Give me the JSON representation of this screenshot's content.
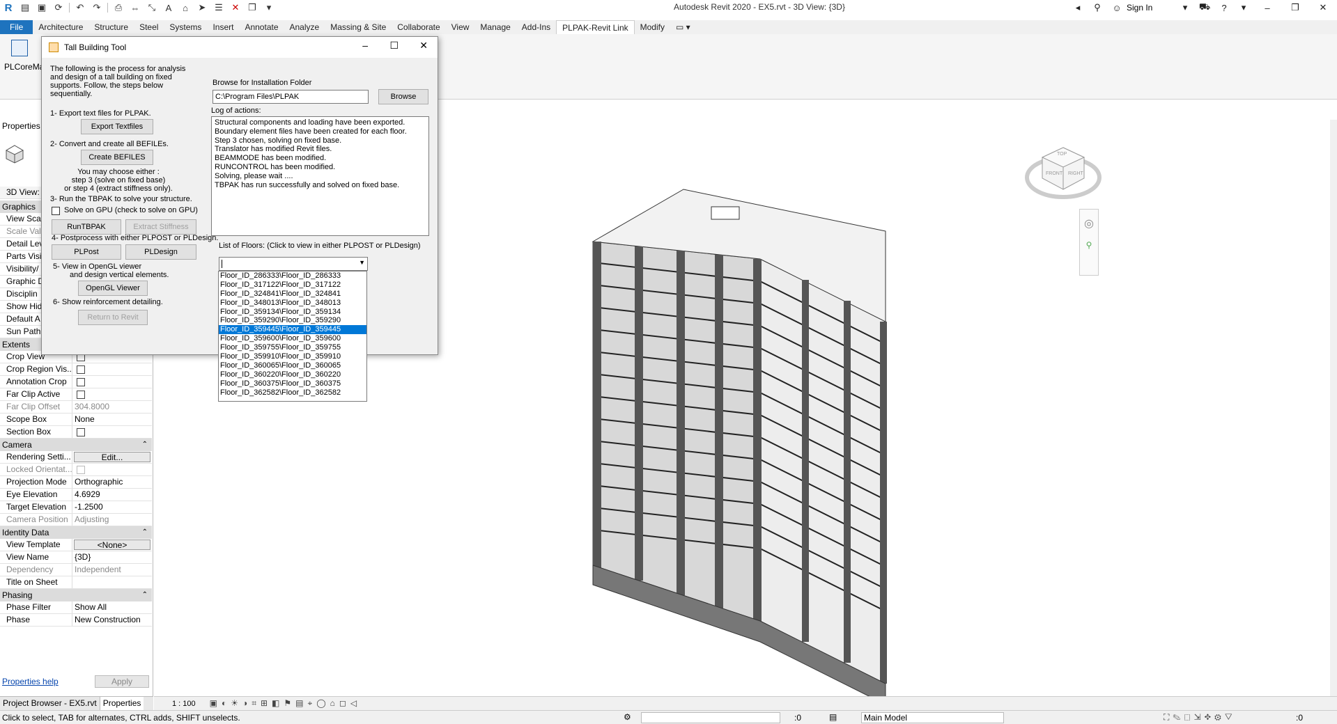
{
  "window": {
    "title": "Autodesk Revit 2020 - EX5.rvt - 3D View: {3D}",
    "sign_in": "Sign In"
  },
  "ribbon": {
    "tabs": [
      "File",
      "Architecture",
      "Structure",
      "Steel",
      "Systems",
      "Insert",
      "Annotate",
      "Analyze",
      "Massing & Site",
      "Collaborate",
      "View",
      "Manage",
      "Add-Ins",
      "PLPAK-Revit Link",
      "Modify"
    ],
    "active_tab": "PLPAK-Revit Link",
    "panel_button_label": "PLCoreMa"
  },
  "properties": {
    "header": "Properties",
    "type_selector": "3D View: {",
    "rows_top": [
      {
        "label": "Graphics",
        "kind": "header"
      },
      {
        "label": "View Scal",
        "kind": "row"
      },
      {
        "label": "Scale Valu",
        "kind": "row",
        "disabled": true
      },
      {
        "label": "Detail Lev",
        "kind": "row"
      },
      {
        "label": "Parts Visil",
        "kind": "row"
      },
      {
        "label": "Visibility/",
        "kind": "row"
      },
      {
        "label": "Graphic D",
        "kind": "row"
      },
      {
        "label": "Disciplin",
        "kind": "row"
      },
      {
        "label": "Show Hid",
        "kind": "row"
      },
      {
        "label": "Default A",
        "kind": "row"
      },
      {
        "label": "Sun Path",
        "kind": "row"
      }
    ],
    "extents_header": "Extents",
    "extents": [
      {
        "label": "Crop View",
        "value": "",
        "checkbox": true
      },
      {
        "label": "Crop Region Vis...",
        "value": "",
        "checkbox": true
      },
      {
        "label": "Annotation Crop",
        "value": "",
        "checkbox": true
      },
      {
        "label": "Far Clip Active",
        "value": "",
        "checkbox": true
      },
      {
        "label": "Far Clip Offset",
        "value": "304.8000",
        "disabled": true
      },
      {
        "label": "Scope Box",
        "value": "None"
      },
      {
        "label": "Section Box",
        "value": "",
        "checkbox": true
      }
    ],
    "camera_header": "Camera",
    "camera": [
      {
        "label": "Rendering Setti...",
        "value": "Edit...",
        "button": true
      },
      {
        "label": "Locked Orientat...",
        "value": "",
        "checkbox": true,
        "disabled": true
      },
      {
        "label": "Projection Mode",
        "value": "Orthographic"
      },
      {
        "label": "Eye Elevation",
        "value": "4.6929"
      },
      {
        "label": "Target Elevation",
        "value": "-1.2500"
      },
      {
        "label": "Camera Position",
        "value": "Adjusting",
        "disabled": true
      }
    ],
    "identity_header": "Identity Data",
    "identity": [
      {
        "label": "View Template",
        "value": "<None>",
        "button": true
      },
      {
        "label": "View Name",
        "value": "{3D}"
      },
      {
        "label": "Dependency",
        "value": "Independent",
        "disabled": true
      },
      {
        "label": "Title on Sheet",
        "value": ""
      }
    ],
    "phasing_header": "Phasing",
    "phasing": [
      {
        "label": "Phase Filter",
        "value": "Show All"
      },
      {
        "label": "Phase",
        "value": "New Construction"
      }
    ],
    "help_link": "Properties help",
    "apply_label": "Apply"
  },
  "bottom_tabs": [
    "Project Browser - EX5.rvt",
    "Properties"
  ],
  "view_controls": {
    "scale": "1 : 100"
  },
  "status": {
    "message": "Click to select, TAB for alternates, CTRL adds, SHIFT unselects.",
    "zero_a": ":0",
    "model": "Main Model",
    "zero_b": ":0"
  },
  "dialog": {
    "title": "Tall Building Tool",
    "intro": [
      "The following is the process for analysis",
      "and design of a tall building on fixed",
      "supports. Follow, the steps below",
      "sequentially."
    ],
    "step1": "1- Export text files for PLPAK.",
    "export_btn": "Export Textfiles",
    "step2": "2- Convert and create all BEFILEs.",
    "create_btn": "Create BEFILES",
    "choose": [
      "You may choose either :",
      "step 3 (solve on fixed base)",
      "or step 4 (extract stiffness only)."
    ],
    "step3": "3- Run the TBPAK to solve your structure.",
    "gpu_label": "Solve on GPU (check to solve on GPU)",
    "run_btn": "RunTBPAK",
    "extract_btn": "Extract Stiffness",
    "step4": "4- Postprocess with either PLPOST or PLDesign.",
    "plpost_btn": "PLPost",
    "pldesign_btn": "PLDesign",
    "step5": [
      "5- View in OpenGL viewer",
      "and design vertical elements."
    ],
    "opengl_btn": "OpenGL Viewer",
    "step6": "6- Show reinforcement detailing.",
    "return_btn": "Return to Revit",
    "browse_label": "Browse for Installation Folder",
    "path_value": "C:\\Program Files\\PLPAK",
    "browse_btn": "Browse",
    "log_label": "Log of actions:",
    "log": [
      "Structural components and loading have been exported.",
      "Boundary element files have been created for each floor.",
      "Step 3 chosen, solving on fixed base.",
      "Translator has modified Revit files.",
      "BEAMMODE has been modified.",
      "RUNCONTROL has been modified.",
      "Solving, please wait ....",
      "TBPAK has run successfully and solved on fixed base."
    ],
    "floors_label": "List of Floors: (Click to view in either PLPOST or PLDesign)",
    "floors": [
      "Floor_ID_286333\\Floor_ID_286333",
      "Floor_ID_317122\\Floor_ID_317122",
      "Floor_ID_324841\\Floor_ID_324841",
      "Floor_ID_348013\\Floor_ID_348013",
      "Floor_ID_359134\\Floor_ID_359134",
      "Floor_ID_359290\\Floor_ID_359290",
      "Floor_ID_359445\\Floor_ID_359445",
      "Floor_ID_359600\\Floor_ID_359600",
      "Floor_ID_359755\\Floor_ID_359755",
      "Floor_ID_359910\\Floor_ID_359910",
      "Floor_ID_360065\\Floor_ID_360065",
      "Floor_ID_360220\\Floor_ID_360220",
      "Floor_ID_360375\\Floor_ID_360375",
      "Floor_ID_362582\\Floor_ID_362582"
    ],
    "selected_floor_index": 6
  },
  "viewcube": {
    "top": "TOP",
    "front": "FRONT",
    "right": "RIGHT"
  }
}
